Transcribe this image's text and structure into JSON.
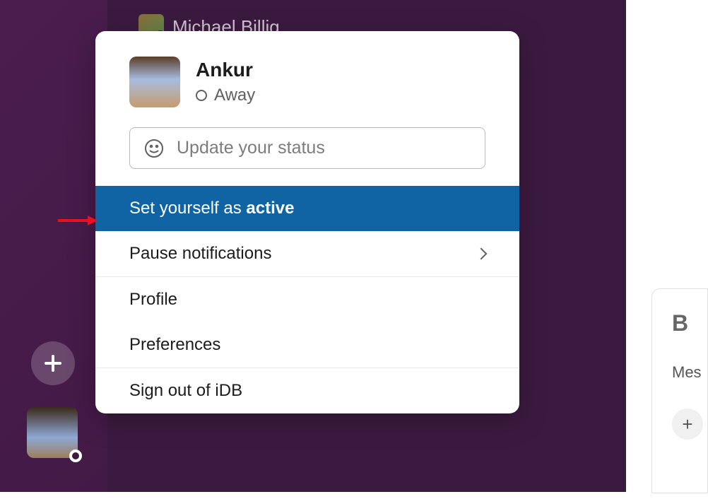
{
  "background": {
    "dm_user": "Michael Billig"
  },
  "popup": {
    "user_name": "Ankur",
    "status_text": "Away",
    "status_placeholder": "Update your status",
    "menu": {
      "set_active_prefix": "Set yourself as ",
      "set_active_bold": "active",
      "pause_notifications": "Pause notifications",
      "profile": "Profile",
      "preferences": "Preferences",
      "sign_out": "Sign out of iDB"
    }
  },
  "right_pane": {
    "bold_letter": "B",
    "message_label": "Mes"
  }
}
